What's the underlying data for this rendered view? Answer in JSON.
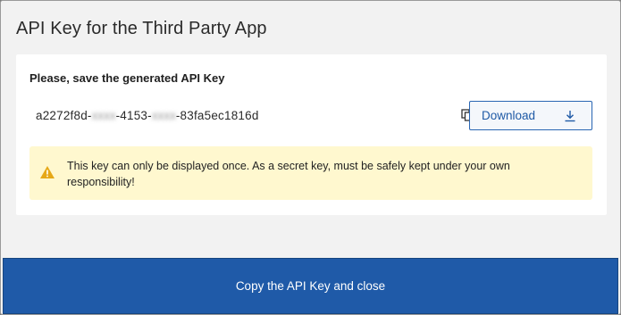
{
  "dialog": {
    "title": "API Key for the Third Party App"
  },
  "panel": {
    "heading": "Please, save the generated API Key",
    "api_key": {
      "part1": "a2272f8d-",
      "masked1": "xxxx",
      "part2": "-4153-",
      "masked2": "xxxx",
      "part3": "-83fa5ec1816d"
    },
    "copy_icon": "copy-icon",
    "download": {
      "label": "Download",
      "icon": "download-icon"
    },
    "warning": {
      "icon": "warning-icon",
      "text": "This key can only be displayed once. As a secret key, must be safely kept under your own responsibility!"
    }
  },
  "footer": {
    "primary_label": "Copy the API Key and close"
  },
  "colors": {
    "accent": "#1f5aa8",
    "warning_bg": "#fff8cf",
    "warning_icon": "#e6a817"
  }
}
